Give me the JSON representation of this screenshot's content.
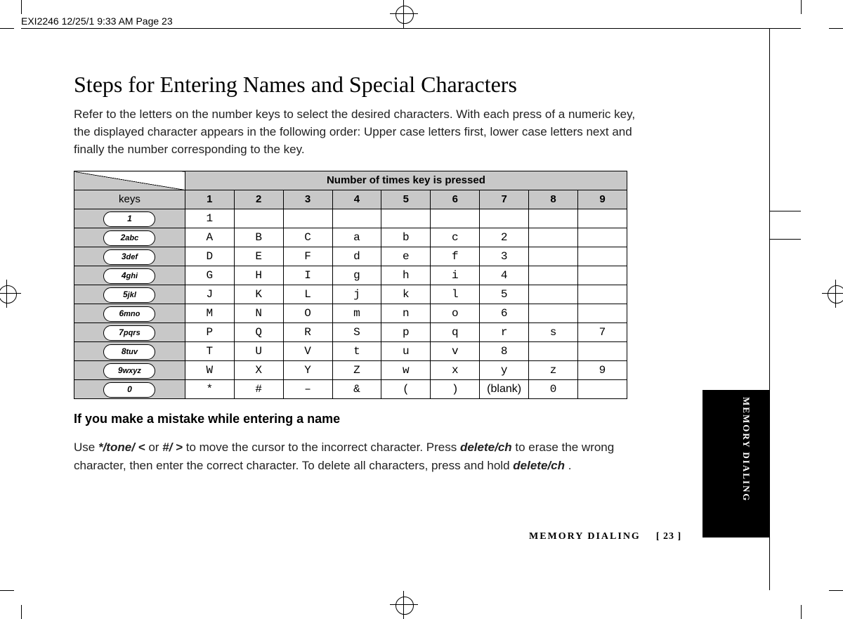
{
  "slug": "EXI2246  12/25/1 9:33 AM  Page 23",
  "title": "Steps for Entering Names and Special Characters",
  "intro": "Refer to the letters on the number keys to select the desired characters. With each press of a numeric key, the displayed character appears in the following order: Upper case letters first, lower case letters next and finally the number corresponding to the key.",
  "table": {
    "banner": "Number of times key is pressed",
    "keys_header": "keys",
    "columns": [
      "1",
      "2",
      "3",
      "4",
      "5",
      "6",
      "7",
      "8",
      "9"
    ],
    "rows": [
      {
        "key_num": "1",
        "key_letters": "",
        "cells": [
          "1",
          "",
          "",
          "",
          "",
          "",
          "",
          "",
          ""
        ]
      },
      {
        "key_num": "2",
        "key_letters": "abc",
        "cells": [
          "A",
          "B",
          "C",
          "a",
          "b",
          "c",
          "2",
          "",
          ""
        ]
      },
      {
        "key_num": "3",
        "key_letters": "def",
        "cells": [
          "D",
          "E",
          "F",
          "d",
          "e",
          "f",
          "3",
          "",
          ""
        ]
      },
      {
        "key_num": "4",
        "key_letters": "ghi",
        "cells": [
          "G",
          "H",
          "I",
          "g",
          "h",
          "i",
          "4",
          "",
          ""
        ]
      },
      {
        "key_num": "5",
        "key_letters": "jkl",
        "cells": [
          "J",
          "K",
          "L",
          "j",
          "k",
          "l",
          "5",
          "",
          ""
        ]
      },
      {
        "key_num": "6",
        "key_letters": "mno",
        "cells": [
          "M",
          "N",
          "O",
          "m",
          "n",
          "o",
          "6",
          "",
          ""
        ]
      },
      {
        "key_num": "7",
        "key_letters": "pqrs",
        "cells": [
          "P",
          "Q",
          "R",
          "S",
          "p",
          "q",
          "r",
          "s",
          "7"
        ]
      },
      {
        "key_num": "8",
        "key_letters": "tuv",
        "cells": [
          "T",
          "U",
          "V",
          "t",
          "u",
          "v",
          "8",
          "",
          ""
        ]
      },
      {
        "key_num": "9",
        "key_letters": "wxyz",
        "cells": [
          "W",
          "X",
          "Y",
          "Z",
          "w",
          "x",
          "y",
          "z",
          "9"
        ]
      },
      {
        "key_num": "0",
        "key_letters": "",
        "cells": [
          "*",
          "#",
          "–",
          "&",
          "(",
          ")",
          "(blank)",
          "0",
          ""
        ]
      }
    ]
  },
  "mistake": {
    "heading": "If you make a mistake while entering a name",
    "t0": "Use ",
    "tok1": "*/tone/ <",
    "t1": " or ",
    "tok2": "#/ >",
    "t2": " to move the cursor to the incorrect character. Press ",
    "tok3": "delete/ch",
    "t3": " to erase the wrong character, then enter the correct character. To delete all characters, press and hold ",
    "tok4": "delete/ch",
    "t4": "."
  },
  "footer_section": "MEMORY DIALING",
  "footer_page": "[ 23 ]",
  "side_tab": "MEMORY DIALING"
}
